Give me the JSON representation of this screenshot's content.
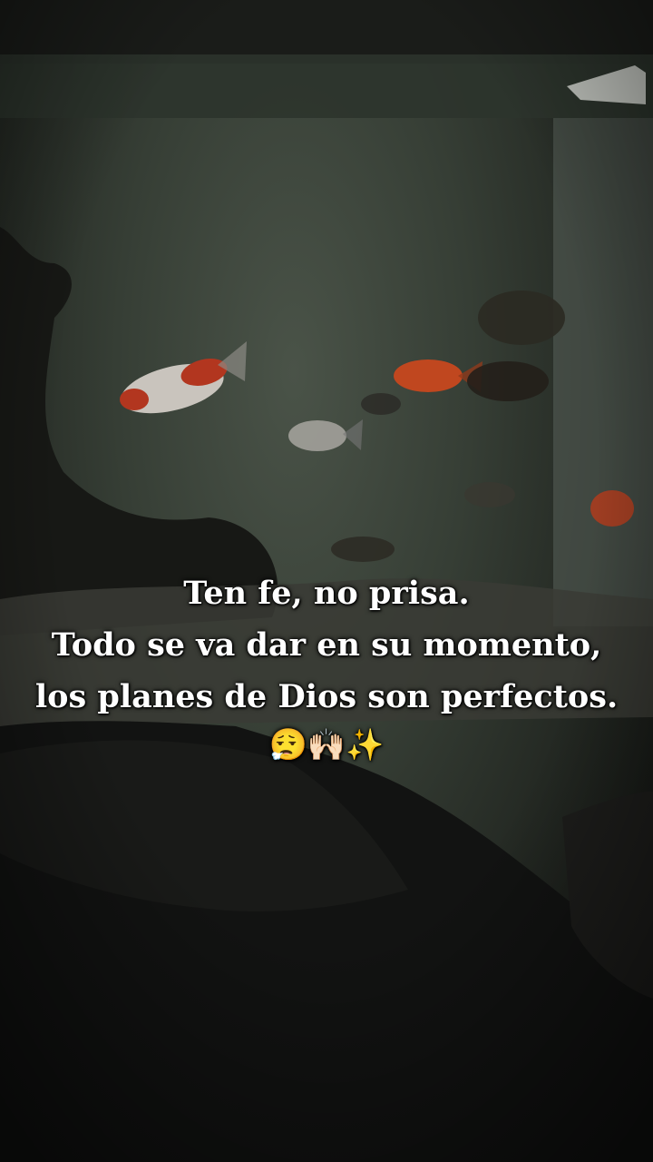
{
  "caption": {
    "line1": "Ten fe, no prisa.",
    "line2": "Todo se va dar en su momento,",
    "line3": "los planes de Dios son perfectos.",
    "emoji": "😮‍💨🙌🏻✨"
  },
  "colors": {
    "text": "#ffffff",
    "text_shadow": "#000000",
    "water": "#3e4740",
    "foreground": "#141514"
  }
}
